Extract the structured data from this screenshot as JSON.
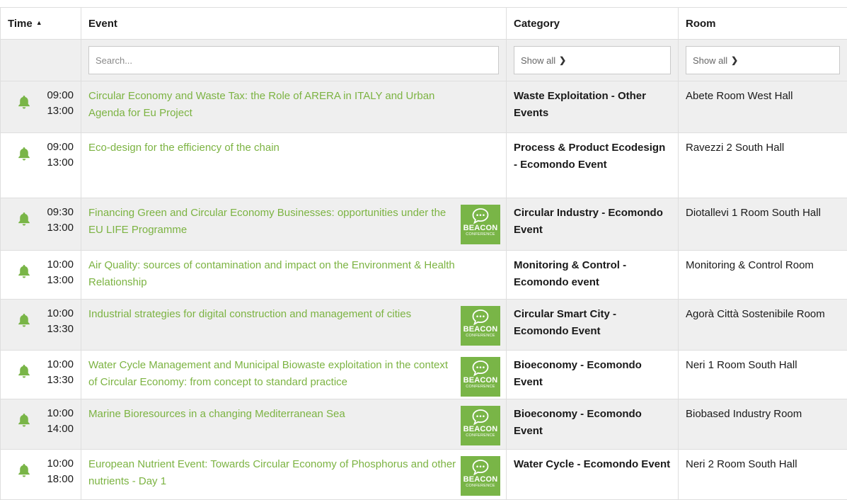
{
  "columns": {
    "time": "Time",
    "event": "Event",
    "category": "Category",
    "room": "Room"
  },
  "sort_indicator": "ascending",
  "filters": {
    "search_placeholder": "Search...",
    "category_select": "Show all",
    "room_select": "Show all"
  },
  "colors": {
    "link_green": "#7cb342",
    "beacon_green": "#79b547",
    "row_grey": "#efefef"
  },
  "beacon_badge": {
    "word": "BEACON",
    "sub": "CONFERENCE"
  },
  "rows": [
    {
      "start": "09:00",
      "end": "13:00",
      "title": "Circular Economy and Waste Tax: the Role of ARERA in ITALY and Urban Agenda for Eu Project",
      "category": "Waste Exploitation - Other Events",
      "room": "Abete Room West Hall",
      "beacon": false
    },
    {
      "start": "09:00",
      "end": "13:00",
      "title": "Eco-design for the efficiency of the chain",
      "category": "Process & Product Ecodesign - Ecomondo Event",
      "room": "Ravezzi 2 South Hall",
      "beacon": false
    },
    {
      "start": "09:30",
      "end": "13:00",
      "title": "Financing Green and Circular Economy Businesses: opportunities under the EU LIFE Programme",
      "category": "Circular Industry - Ecomondo Event",
      "room": "Diotallevi 1 Room South Hall",
      "beacon": true
    },
    {
      "start": "10:00",
      "end": "13:00",
      "title": "Air Quality: sources of contamination and impact on the Environment & Health Relationship",
      "category": "Monitoring & Control - Ecomondo event",
      "room": "Monitoring & Control Room",
      "beacon": false
    },
    {
      "start": "10:00",
      "end": "13:30",
      "title": "Industrial strategies for digital construction and management of cities",
      "category": "Circular Smart City - Ecomondo Event",
      "room": "Agorà Città Sostenibile Room",
      "beacon": true
    },
    {
      "start": "10:00",
      "end": "13:30",
      "title": "Water Cycle Management and Municipal Biowaste exploitation in the context of Circular Economy: from concept to standard practice",
      "category": "Bioeconomy - Ecomondo Event",
      "room": "Neri 1 Room South Hall",
      "beacon": true
    },
    {
      "start": "10:00",
      "end": "14:00",
      "title": "Marine Bioresources in a changing Mediterranean Sea",
      "category": "Bioeconomy - Ecomondo Event",
      "room": "Biobased Industry Room",
      "beacon": true
    },
    {
      "start": "10:00",
      "end": "18:00",
      "title": "European Nutrient Event: Towards Circular Economy of Phosphorus and other nutrients - Day 1",
      "category": "Water Cycle - Ecomondo Event",
      "room": "Neri 2 Room South Hall",
      "beacon": true
    }
  ]
}
